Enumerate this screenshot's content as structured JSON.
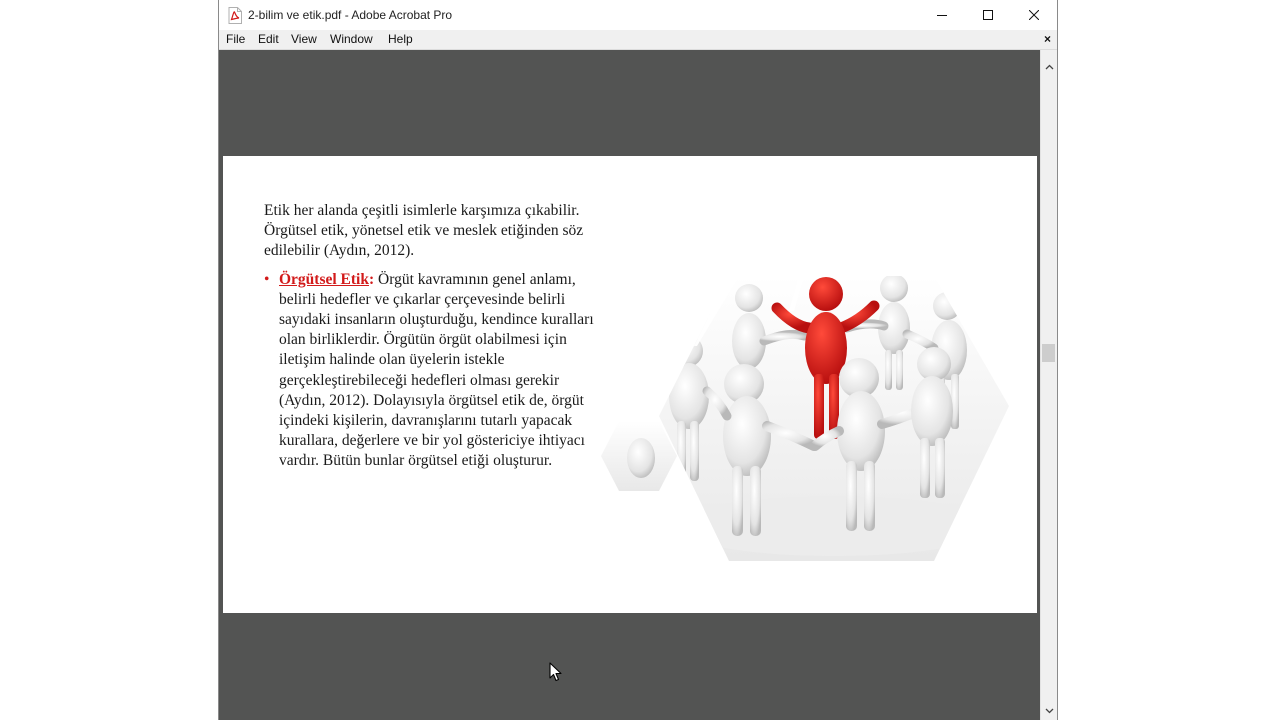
{
  "window": {
    "title": "2-bilim ve etik.pdf - Adobe Acrobat Pro",
    "app_icon": "pdf-file-icon"
  },
  "menu": {
    "file": "File",
    "edit": "Edit",
    "view": "View",
    "window": "Window",
    "help": "Help",
    "close_glyph": "×"
  },
  "slide": {
    "intro": "Etik her alanda çeşitli isimlerle karşımıza çıkabilir. Örgütsel etik, yönetsel etik ve meslek etiğinden söz edilebilir (Aydın, 2012).",
    "bullet_symbol": "•",
    "bullet_term": "Örgütsel Etik",
    "bullet_colon": ":",
    "bullet_text": " Örgüt kavramının genel anlamı, belirli hedefler ve çıkarlar çerçevesinde belirli sayıdaki insanların oluşturduğu, kendince kuralları olan birliklerdir. Örgütün örgüt olabilmesi için iletişim halinde olan üyelerin istekle gerçekleştirebileceği hedefleri olması gerekir (Aydın, 2012). Dolayısıyla örgütsel etik de, örgüt içindeki kişilerin, davranışlarını tutarlı yapacak kurallara, değerlere ve bir yol göstericiye ihtiyacı vardır. Bütün bunlar örgütsel etiği oluşturur."
  },
  "colors": {
    "viewer_background": "#535453",
    "accent_red": "#d21a1a",
    "menubar": "#f0f0f0"
  },
  "icons": [
    "pdf-file-icon",
    "minimize-icon",
    "maximize-icon",
    "close-icon",
    "chevron-up-icon",
    "chevron-down-icon",
    "mouse-pointer-icon"
  ]
}
